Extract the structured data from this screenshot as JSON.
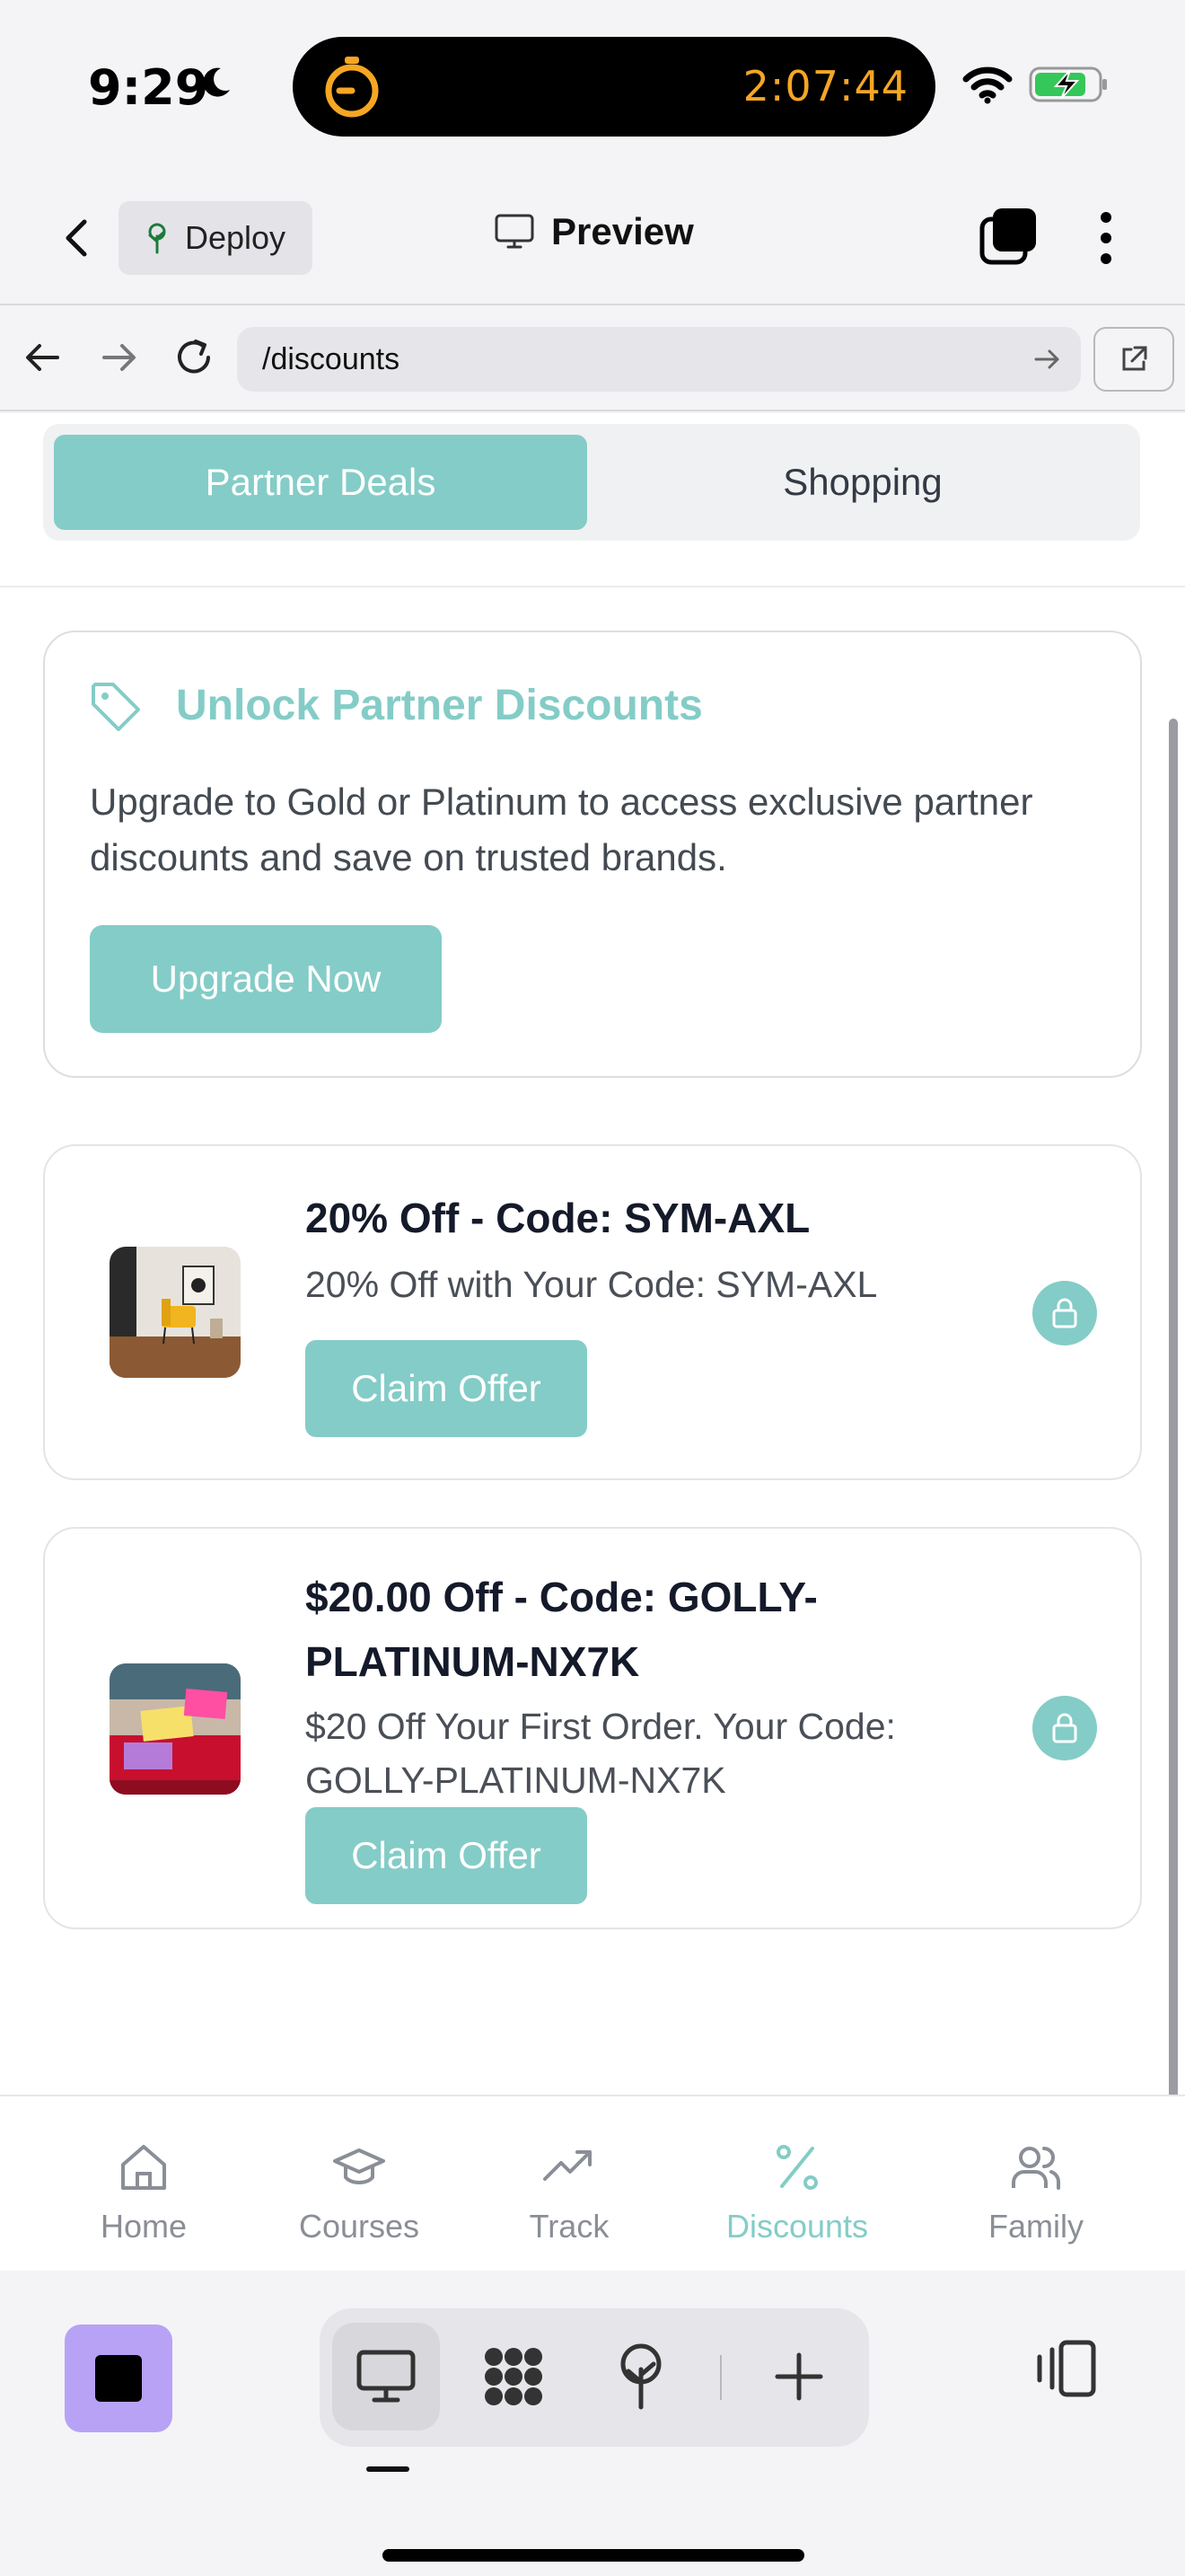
{
  "status_bar": {
    "time": "9:29",
    "timer": "2:07:44"
  },
  "header": {
    "deploy_label": "Deploy",
    "preview_label": "Preview"
  },
  "url_bar": {
    "path": "/discounts"
  },
  "segment": {
    "tabs": [
      "Partner Deals",
      "Shopping"
    ],
    "active": "Partner Deals"
  },
  "unlock_card": {
    "title": "Unlock Partner Discounts",
    "description": "Upgrade to Gold or Platinum to access exclusive partner discounts and save on trusted brands.",
    "button": "Upgrade Now"
  },
  "offers": [
    {
      "title": "20% Off - Code: SYM-AXL",
      "description": "20% Off with Your Code: SYM-AXL",
      "button": "Claim Offer",
      "image": "living-room-photo",
      "locked": true
    },
    {
      "title": "$20.00 Off - Code: GOLLY-PLATINUM-NX7K",
      "description": "$20 Off Your First Order. Your Code: GOLLY-PLATINUM-NX7K",
      "button": "Claim Offer",
      "image": "sticky-notes-photo",
      "locked": true
    }
  ],
  "bottom_nav": {
    "items": [
      "Home",
      "Courses",
      "Track",
      "Discounts",
      "Family"
    ],
    "active": "Discounts"
  },
  "colors": {
    "accent": "#84ccc7",
    "timer": "#f5a623",
    "app_square": "#b7a2f5"
  }
}
